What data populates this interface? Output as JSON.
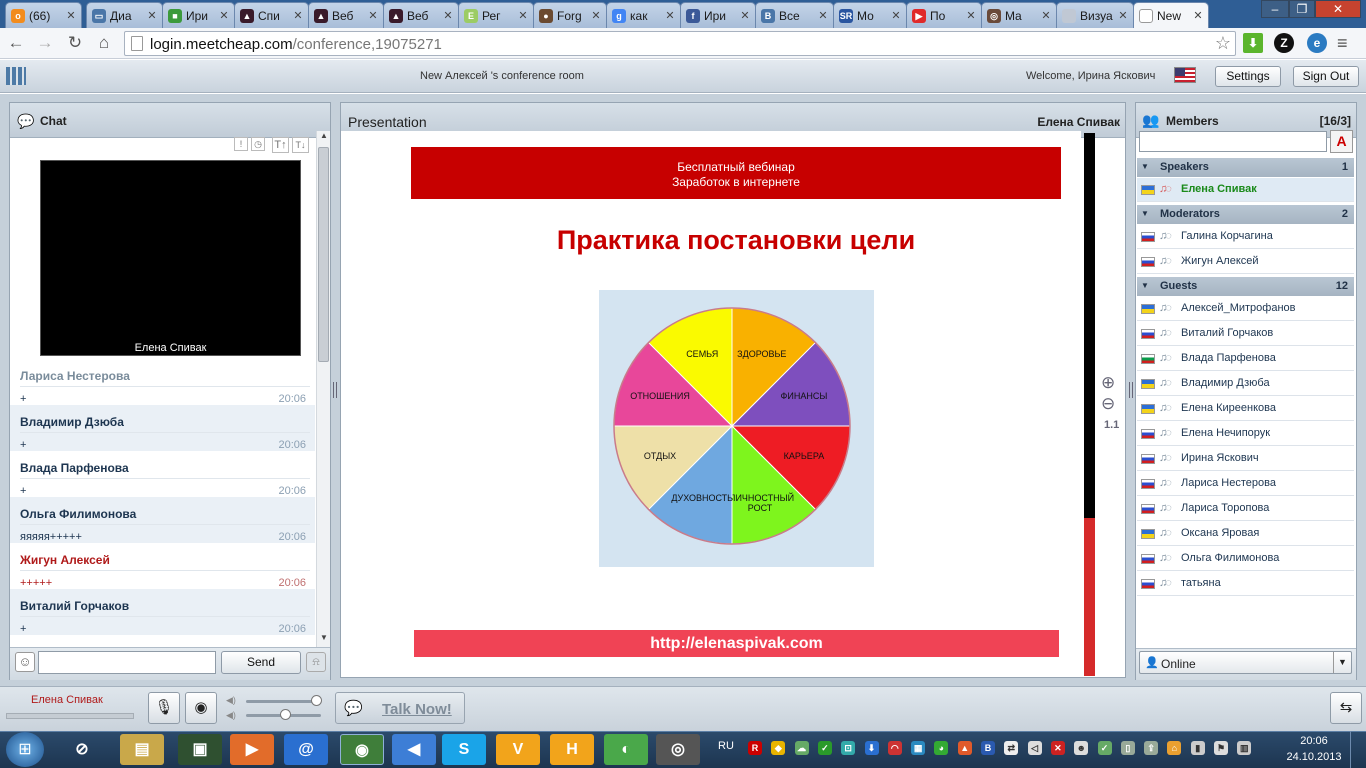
{
  "browser": {
    "tabs": [
      {
        "label": "(66)",
        "icon": "odnoklassniki-icon",
        "color": "#f28c1e",
        "glyph": "о"
      },
      {
        "label": "Диа",
        "icon": "chat-icon",
        "color": "#4a76a8",
        "glyph": "▭"
      },
      {
        "label": "Ири",
        "icon": "page-icon",
        "color": "#3c9a3c",
        "glyph": "■"
      },
      {
        "label": "Спи",
        "icon": "graduate-icon",
        "color": "#3a1a2a",
        "glyph": "▲"
      },
      {
        "label": "Веб",
        "icon": "graduate-icon",
        "color": "#3a1a2a",
        "glyph": "▲"
      },
      {
        "label": "Веб",
        "icon": "graduate-icon",
        "color": "#3a1a2a",
        "glyph": "▲"
      },
      {
        "label": "Рег",
        "icon": "e-icon",
        "color": "#9ccc65",
        "glyph": "E"
      },
      {
        "label": "Forg",
        "icon": "avatar-icon",
        "color": "#6b4a30",
        "glyph": "●"
      },
      {
        "label": "как",
        "icon": "google-icon",
        "color": "#4285f4",
        "glyph": "g"
      },
      {
        "label": "Ири",
        "icon": "facebook-icon",
        "color": "#3b5998",
        "glyph": "f"
      },
      {
        "label": "Все",
        "icon": "vk-icon",
        "color": "#4a76a8",
        "glyph": "B"
      },
      {
        "label": "Мо",
        "icon": "sr-icon",
        "color": "#2a55a0",
        "glyph": "SR"
      },
      {
        "label": "По",
        "icon": "youtube-icon",
        "color": "#e02a2a",
        "glyph": "▶"
      },
      {
        "label": "Ma",
        "icon": "globe-icon",
        "color": "#6a4a3a",
        "glyph": "◎"
      },
      {
        "label": "Визуа",
        "icon": "blank-icon",
        "color": "#c0c8d4",
        "glyph": ""
      },
      {
        "label": "New",
        "icon": "page-icon",
        "color": "#ffffff",
        "glyph": ""
      }
    ],
    "url_host": "login.meetcheap.com",
    "url_path": "/conference,19075271"
  },
  "header": {
    "room_title": "New Алексей 's conference room",
    "welcome": "Welcome, Ирина Яскович",
    "settings_label": "Settings",
    "signout_label": "Sign Out"
  },
  "chat": {
    "title": "Chat",
    "video_caption": "Елена  Спивак",
    "messages": [
      {
        "name": "Лариса Нестерова",
        "text": "+",
        "time": "20:06",
        "color": "#7a8c9b"
      },
      {
        "name": "Владимир Дзюба",
        "text": "+",
        "time": "20:06",
        "color": "#1d3550"
      },
      {
        "name": "Влада Парфенова",
        "text": "+",
        "time": "20:06",
        "color": "#1d3550"
      },
      {
        "name": "Ольга Филимонова",
        "text": "яяяяя+++++",
        "time": "20:06",
        "color": "#1d3550"
      },
      {
        "name": "Жигун Алексей",
        "text": "+++++",
        "time": "20:06",
        "color": "#b01a1a"
      },
      {
        "name": "Виталий Горчаков",
        "text": "+",
        "time": "20:06",
        "color": "#1d3550"
      }
    ],
    "send_label": "Send"
  },
  "presentation": {
    "title": "Presentation",
    "presenter": "Елена  Спивак",
    "zoom": "1.1",
    "slide": {
      "banner_line1": "Бесплатный  вебинар",
      "banner_line2": "Заработок в интернете",
      "heading": "Практика постановки цели",
      "footer_url": "http://elenaspivak.com",
      "wheel": [
        {
          "label": "ЗДОРОВЬЕ",
          "color": "#f9b100"
        },
        {
          "label": "ФИНАНСЫ",
          "color": "#7e4fbe"
        },
        {
          "label": "КАРЬЕРА",
          "color": "#ee1c24"
        },
        {
          "label": "ЛИЧНОСТНЫЙ",
          "label2": "РОСТ",
          "color": "#7ef51d"
        },
        {
          "label": "ДУХОВНОСТЬ",
          "color": "#6fa8e0"
        },
        {
          "label": "ОТДЫХ",
          "color": "#eee0a8"
        },
        {
          "label": "ОТНОШЕНИЯ",
          "color": "#e8479a"
        },
        {
          "label": "СЕМЬЯ",
          "color": "#fafa00"
        }
      ]
    }
  },
  "members": {
    "title": "Members",
    "count": "[16/3]",
    "groups": [
      {
        "label": "Speakers",
        "count": "1",
        "people": [
          {
            "name": "Елена  Спивак",
            "flag": "ua",
            "active": true
          }
        ]
      },
      {
        "label": "Moderators",
        "count": "2",
        "people": [
          {
            "name": "Галина Корчагина",
            "flag": "ru"
          },
          {
            "name": "Жигун Алексей",
            "flag": "ru"
          }
        ]
      },
      {
        "label": "Guests",
        "count": "12",
        "people": [
          {
            "name": "Алексей_Митрофанов",
            "flag": "ua"
          },
          {
            "name": "Виталий Горчаков",
            "flag": "ru"
          },
          {
            "name": "Влада Парфенова",
            "flag": "bg"
          },
          {
            "name": "Владимир Дзюба",
            "flag": "ua"
          },
          {
            "name": "Елена Киреенкова",
            "flag": "ua"
          },
          {
            "name": "Елена Нечипорук",
            "flag": "ru"
          },
          {
            "name": "Ирина Яскович",
            "flag": "ru"
          },
          {
            "name": "Лариса Нестерова",
            "flag": "ru"
          },
          {
            "name": "Лариса Торопова",
            "flag": "ru"
          },
          {
            "name": "Оксана Яровая",
            "flag": "ua"
          },
          {
            "name": "Ольга Филимонова",
            "flag": "ru"
          },
          {
            "name": "татьяна",
            "flag": "ru"
          }
        ]
      }
    ],
    "status": "Online"
  },
  "footer": {
    "speaker_name": "Елена  Спивак",
    "talk_label": "Talk Now!"
  },
  "taskbar": {
    "lang": "RU",
    "time": "20:06",
    "date": "24.10.2013"
  }
}
